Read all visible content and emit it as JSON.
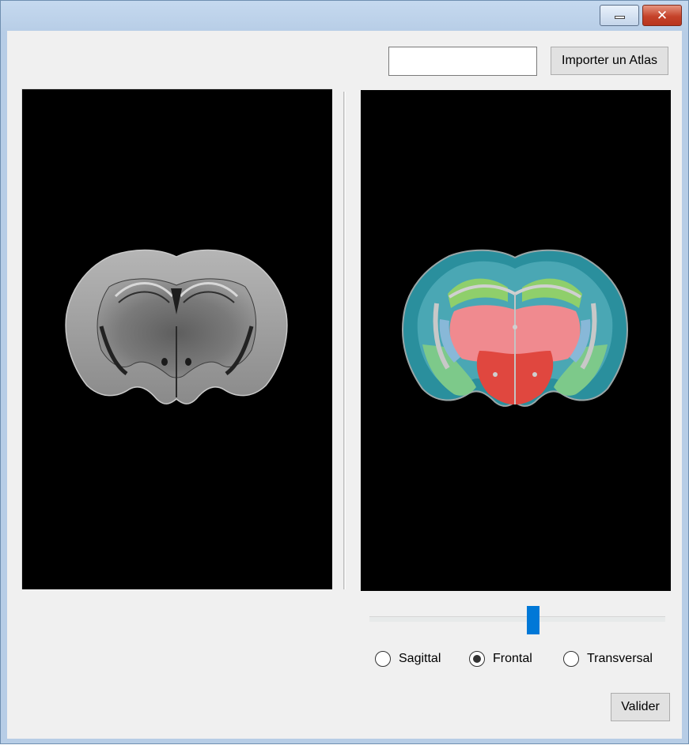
{
  "window": {
    "title": "",
    "minimize_glyph": "minimize-icon",
    "close_glyph": "✕"
  },
  "toolbar": {
    "atlas_path_value": "",
    "atlas_path_placeholder": "",
    "import_button_label": "Importer un Atlas"
  },
  "viewers": {
    "left": {
      "content": "grayscale-brain-slice-image"
    },
    "right": {
      "content": "colored-atlas-brain-slice-image"
    }
  },
  "slice_slider": {
    "position_fraction": 0.55
  },
  "orientation": {
    "options": [
      {
        "label": "Sagittal",
        "checked": false
      },
      {
        "label": "Frontal",
        "checked": true
      },
      {
        "label": "Transversal",
        "checked": false
      }
    ]
  },
  "actions": {
    "validate_button_label": "Valider"
  },
  "colors": {
    "accent": "#0078d7",
    "viewer_background": "#000000",
    "client_background": "#f0f0f0"
  }
}
